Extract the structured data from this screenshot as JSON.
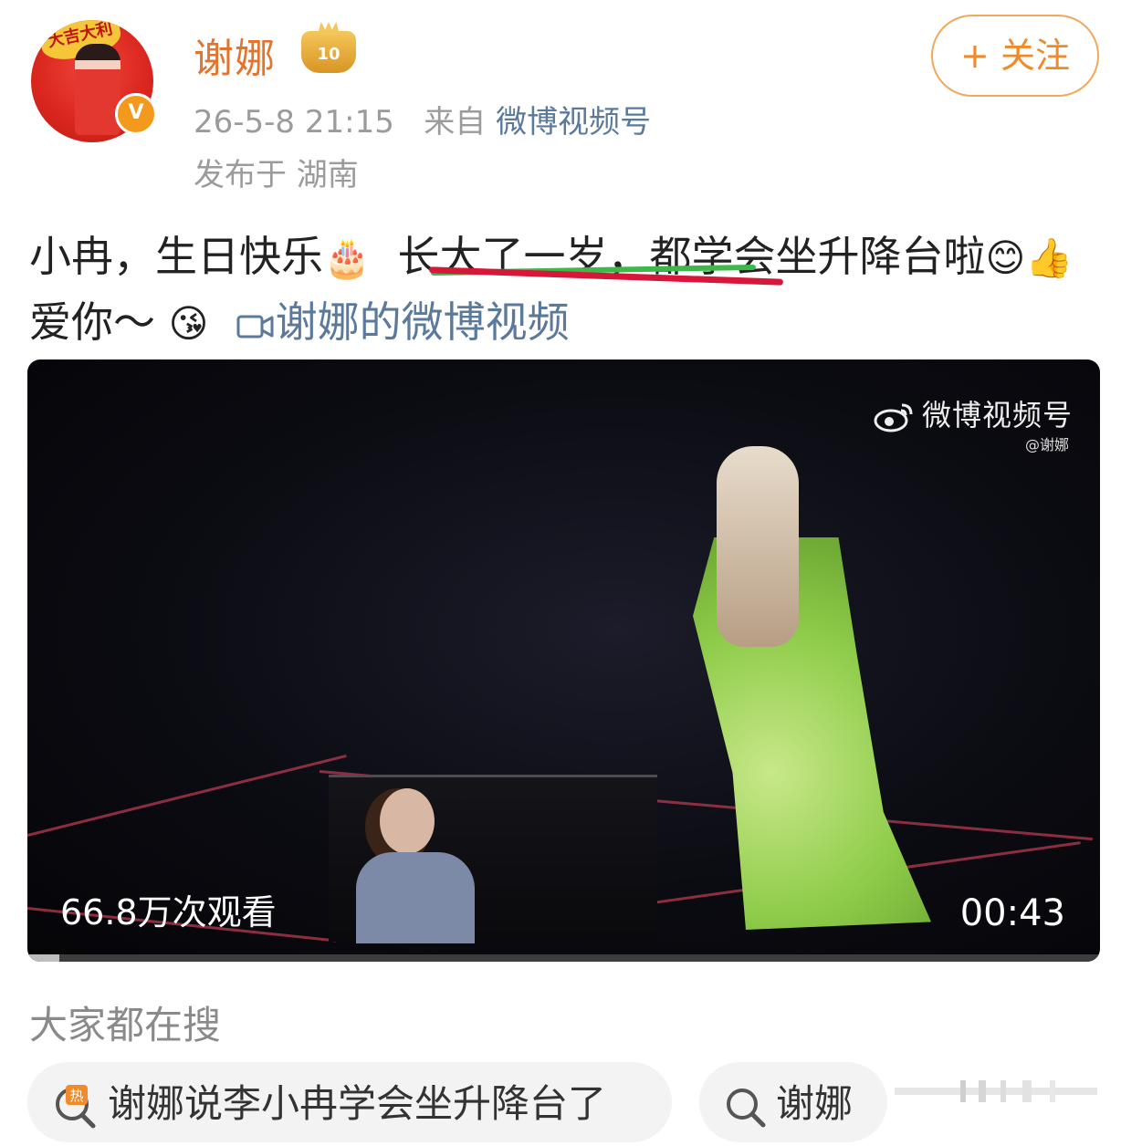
{
  "user": {
    "name": "谢娜",
    "avatar_banner": "大吉大利",
    "verified_badge": "V",
    "level_badge": "10"
  },
  "post_meta": {
    "time": "26-5-8 21:15",
    "from_label": "来自",
    "source": "微博视频号",
    "location": "发布于 湖南"
  },
  "follow_button": {
    "label": "+ 关注"
  },
  "post": {
    "text_part1": "小冉，生日快乐",
    "emoji_cake": "🎂",
    "text_part2": "长大了一岁，都学会坐升降台啦",
    "emoji_smile": "😊",
    "emoji_thumb": "👍",
    "text_part3": "爱你～",
    "emoji_kiss": "😘",
    "video_link_label": "谢娜的微博视频"
  },
  "video": {
    "watermark": "微博视频号",
    "watermark_handle": "@谢娜",
    "views": "66.8万次观看",
    "duration": "00:43",
    "progress_fraction": 0.03
  },
  "search_section": {
    "title": "大家都在搜",
    "chips": [
      {
        "icon": "hot-search-icon",
        "label": "谢娜说李小冉学会坐升降台了"
      },
      {
        "icon": "search-icon",
        "label": "谢娜"
      }
    ]
  },
  "colors": {
    "username": "#e3742e",
    "follow": "#ee8a2a",
    "link": "#5b7a9b",
    "meta": "#9b9b9b"
  }
}
